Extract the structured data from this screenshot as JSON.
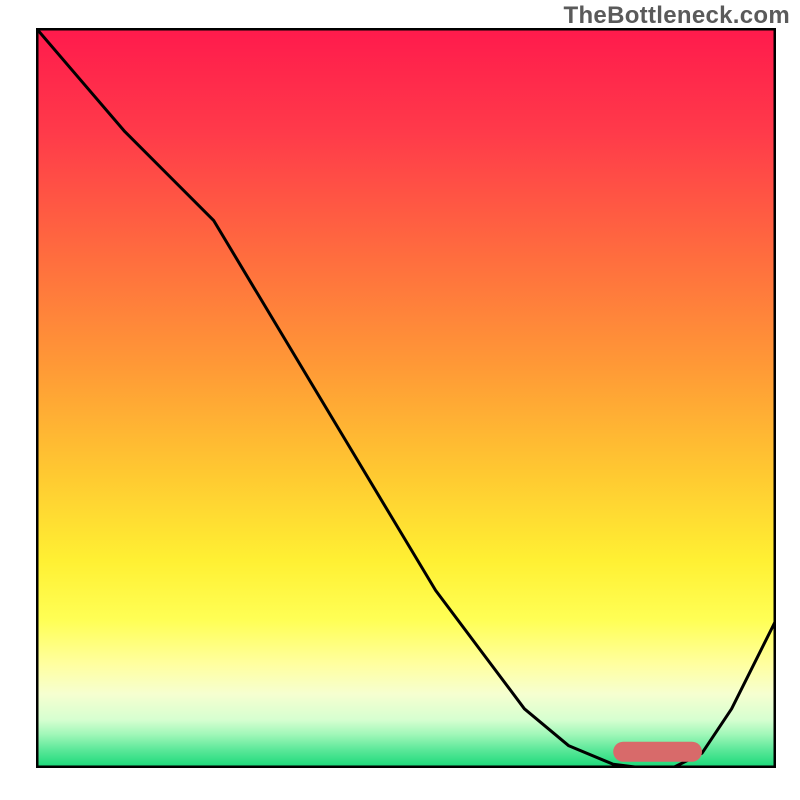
{
  "watermark": {
    "text": "TheBottleneck.com"
  },
  "colors": {
    "gradient": [
      {
        "stop": 0.0,
        "hex": "#ff1a4c"
      },
      {
        "stop": 0.14,
        "hex": "#ff3a4a"
      },
      {
        "stop": 0.3,
        "hex": "#ff6a3f"
      },
      {
        "stop": 0.46,
        "hex": "#ff9a36"
      },
      {
        "stop": 0.6,
        "hex": "#ffc831"
      },
      {
        "stop": 0.72,
        "hex": "#fff033"
      },
      {
        "stop": 0.8,
        "hex": "#ffff55"
      },
      {
        "stop": 0.86,
        "hex": "#ffffa0"
      },
      {
        "stop": 0.9,
        "hex": "#f6ffd0"
      },
      {
        "stop": 0.935,
        "hex": "#d6ffd0"
      },
      {
        "stop": 0.955,
        "hex": "#9ff7b8"
      },
      {
        "stop": 0.975,
        "hex": "#5de89a"
      },
      {
        "stop": 1.0,
        "hex": "#17d877"
      }
    ],
    "frame": "#000000",
    "curve": "#000000",
    "marker": "#d86a6a"
  },
  "chart_data": {
    "type": "line",
    "title": "",
    "xlabel": "",
    "ylabel": "",
    "xlim": [
      0,
      100
    ],
    "ylim": [
      0,
      100
    ],
    "x": [
      0,
      6,
      12,
      18,
      24,
      30,
      36,
      42,
      48,
      54,
      60,
      66,
      72,
      78,
      82,
      86,
      90,
      94,
      100
    ],
    "series": [
      {
        "name": "bottleneck-curve",
        "values": [
          100,
          93,
          86,
          80,
          74,
          64,
          54,
          44,
          34,
          24,
          16,
          8,
          3,
          0.5,
          0,
          0,
          2,
          8,
          20
        ]
      }
    ],
    "annotations": [
      {
        "name": "optimal-range",
        "x0": 78,
        "x1": 90,
        "y": 2.2
      }
    ]
  }
}
